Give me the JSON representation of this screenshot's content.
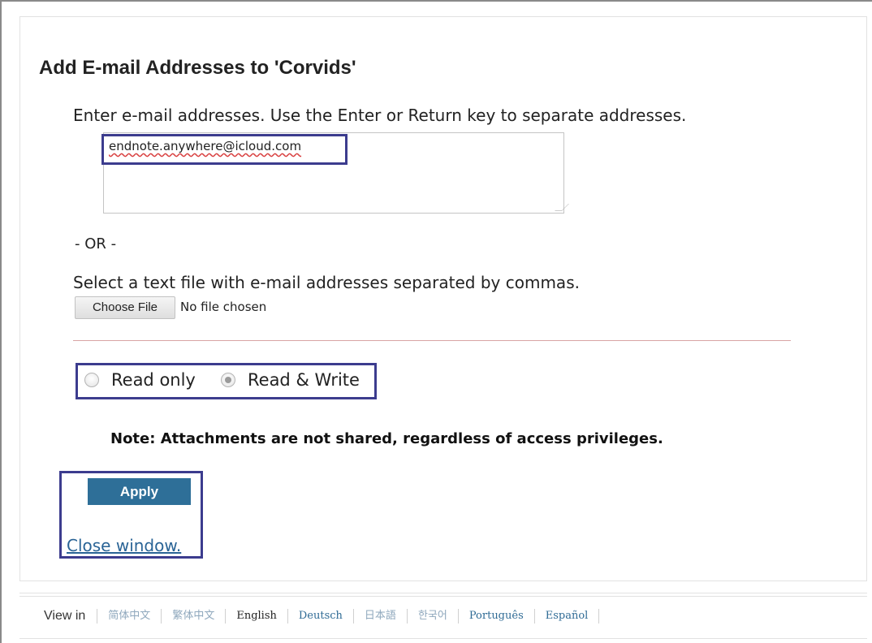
{
  "dialog": {
    "title": "Add E-mail Addresses to 'Corvids'",
    "instructions": "Enter e-mail addresses. Use the Enter or Return key to separate addresses.",
    "email_value": "endnote.anywhere@icloud.com",
    "or_separator": "- OR -",
    "file_instructions": "Select a text file with e-mail addresses separated by commas.",
    "choose_file_label": "Choose File",
    "no_file_text": "No file chosen",
    "access": {
      "read_only_label": "Read only",
      "read_write_label": "Read & Write",
      "selected": "Read & Write"
    },
    "note": "Note: Attachments are not shared, regardless of access privileges.",
    "apply_label": "Apply",
    "close_label": "Close window."
  },
  "footer": {
    "view_in": "View in",
    "languages": [
      "简体中文",
      "繁体中文",
      "English",
      "Deutsch",
      "日本語",
      "한국어",
      "Português",
      "Español"
    ],
    "current_language": "English"
  },
  "colors": {
    "highlight_border": "#3c3c8e",
    "apply_button": "#2e6f98",
    "link": "#2a6496"
  }
}
